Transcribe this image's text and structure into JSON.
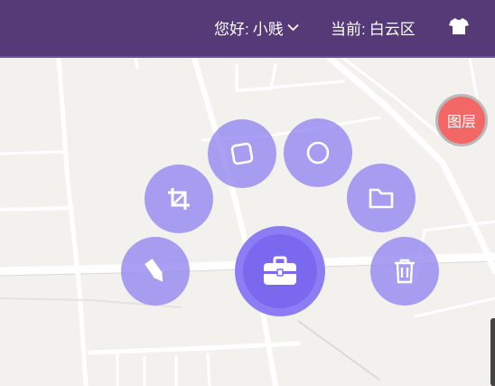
{
  "header": {
    "greeting_label": "您好:",
    "user_name": "小贱",
    "current_label": "当前:",
    "current_district": "白云区",
    "bg_color": "#563a77"
  },
  "tools": [
    {
      "name": "pencil",
      "icon": "pencil-icon"
    },
    {
      "name": "crop",
      "icon": "crop-icon"
    },
    {
      "name": "square",
      "icon": "square-icon"
    },
    {
      "name": "circle",
      "icon": "circle-icon"
    },
    {
      "name": "folder",
      "icon": "folder-icon"
    },
    {
      "name": "trash",
      "icon": "trash-icon"
    }
  ],
  "main_button": {
    "icon": "briefcase-icon",
    "color": "#7a68ee"
  },
  "layer_button": {
    "label": "图层",
    "color": "#f46767"
  },
  "colors": {
    "tool_bg": "#968af0",
    "map_bg": "#f2f1ee",
    "road": "#ffffff"
  }
}
